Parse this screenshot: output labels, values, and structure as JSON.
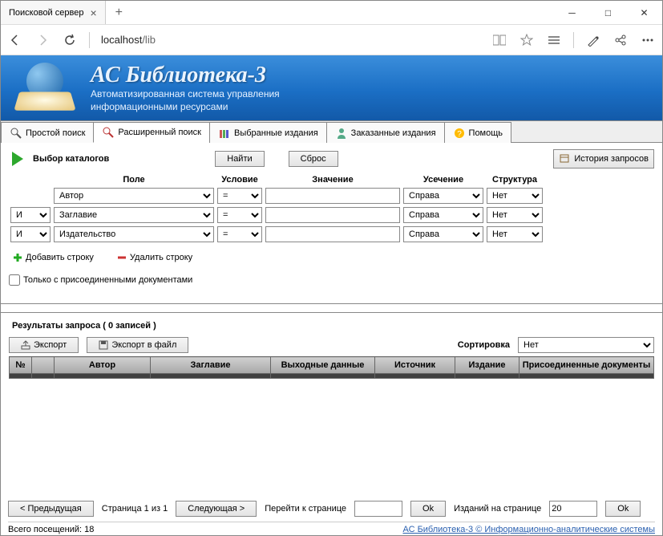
{
  "window": {
    "tab_title": "Поисковой сервер",
    "url_host": "localhost",
    "url_path": "/lib"
  },
  "banner": {
    "title": "АС Библиотека-3",
    "subtitle1": "Автоматизированная система управления",
    "subtitle2": "информационными ресурсами"
  },
  "tabs": [
    "Простой поиск",
    "Расширенный поиск",
    "Выбранные издания",
    "Заказанные издания",
    "Помощь"
  ],
  "toolbar": {
    "catalog_label": "Выбор каталогов",
    "find": "Найти",
    "reset": "Сброс",
    "history": "История запросов"
  },
  "query": {
    "headers": {
      "field": "Поле",
      "cond": "Условие",
      "value": "Значение",
      "trunc": "Усечение",
      "struct": "Структура"
    },
    "op": "И",
    "rows": [
      {
        "field": "Автор",
        "cond": "=",
        "value": "",
        "trunc": "Справа",
        "struct": "Нет"
      },
      {
        "field": "Заглавие",
        "cond": "=",
        "value": "",
        "trunc": "Справа",
        "struct": "Нет"
      },
      {
        "field": "Издательство",
        "cond": "=",
        "value": "",
        "trunc": "Справа",
        "struct": "Нет"
      }
    ],
    "add_row": "Добавить строку",
    "del_row": "Удалить строку",
    "attached": "Только с присоединенными документами"
  },
  "results": {
    "header": "Результаты запроса  ( 0 записей )",
    "export": "Экспорт",
    "export_file": "Экспорт в файл",
    "sort_label": "Сортировка",
    "sort_value": "Нет",
    "columns": [
      "№",
      "",
      "Автор",
      "Заглавие",
      "Выходные данные",
      "Источник",
      "Издание",
      "Присоединенные документы"
    ]
  },
  "pager": {
    "prev": "< Предыдущая",
    "page_label": "Страница 1 из 1",
    "next": "Следующая >",
    "goto_label": "Перейти к странице",
    "goto_ok": "Ok",
    "perpage_label": "Изданий на странице",
    "perpage_value": "20",
    "perpage_ok": "Ok"
  },
  "footer": {
    "visits": "Всего посещений: 18",
    "link": "АС Библиотека-3 © Информационно-аналитические системы"
  }
}
